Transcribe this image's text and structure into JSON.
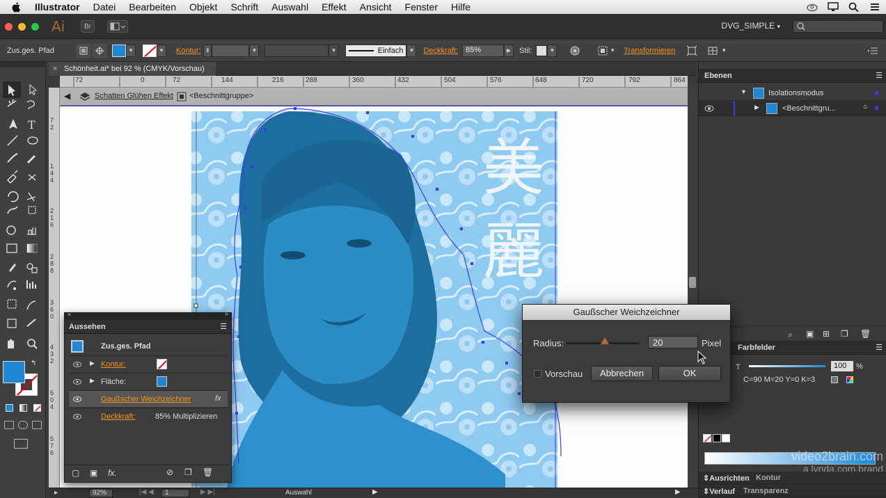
{
  "menubar": {
    "app": "Illustrator",
    "items": [
      "Datei",
      "Bearbeiten",
      "Objekt",
      "Schrift",
      "Auswahl",
      "Effekt",
      "Ansicht",
      "Fenster",
      "Hilfe"
    ]
  },
  "appbar": {
    "logo": "Ai",
    "bridge": "Br",
    "workspace": "DVG_SIMPLE"
  },
  "controlbar": {
    "selection": "Zus.ges. Pfad",
    "kontur_label": "Kontur:",
    "stroke_style": "Einfach",
    "deckkraft_label": "Deckkraft:",
    "deckkraft_value": "85%",
    "stil_label": "Stil:",
    "transform_label": "Transformieren"
  },
  "document": {
    "tab_title": "Schönheit.ai* bei 92 % (CMYK/Vorschau)",
    "breadcrumb_1": "Schatten Glühen Effekt",
    "breadcrumb_2": "<Beschnittgruppe>",
    "hruler_ticks": [
      "72",
      "0",
      "72",
      "144",
      "216",
      "288",
      "360",
      "432",
      "504",
      "576",
      "648",
      "720",
      "792",
      "864"
    ],
    "vruler_ticks": [
      "7 2",
      "1 4 4",
      "2 1 6",
      "2 8 8",
      "3 6 0",
      "4 3 2",
      "5 0 4",
      "5 7 6"
    ],
    "calligraphy": "美麗"
  },
  "statusbar": {
    "zoom": "92%",
    "page": "1",
    "mode": "Auswahl"
  },
  "layers": {
    "title": "Ebenen",
    "isolation": "Isolationsmodus",
    "clipgroup": "<Beschnittgru..."
  },
  "color_panel": {
    "tab_farbfelder": "Farbfelder",
    "tint_label": "T",
    "tint_value": "100",
    "percent": "%",
    "cmyk": "C=90 M=20 Y=0 K=3"
  },
  "bottom_panels": {
    "ausrichten": "Ausrichten",
    "kontur": "Kontur",
    "verlauf": "Verlauf",
    "transparenz": "Transparenz"
  },
  "watermark": {
    "line1": "video2brain.com",
    "line2": "a lynda.com brand"
  },
  "aussehen": {
    "title": "Aussehen",
    "object": "Zus.ges. Pfad",
    "kontur": "Kontur:",
    "flaeche": "Fläche:",
    "effect": "Gaußscher Weichzeichner",
    "fx": "fx",
    "deckkraft": "Deckkraft:",
    "deckkraft_value": "85% Multiplizieren"
  },
  "dialog": {
    "title": "Gaußscher Weichzeichner",
    "radius_label": "Radius:",
    "radius_value": "20",
    "unit": "Pixel",
    "preview": "Vorschau",
    "cancel": "Abbrechen",
    "ok": "OK",
    "slider_position": 0.53
  },
  "colors": {
    "accent": "#f7931e",
    "fill_blue": "#1e88d6",
    "selection_blue": "#3a3aff"
  }
}
